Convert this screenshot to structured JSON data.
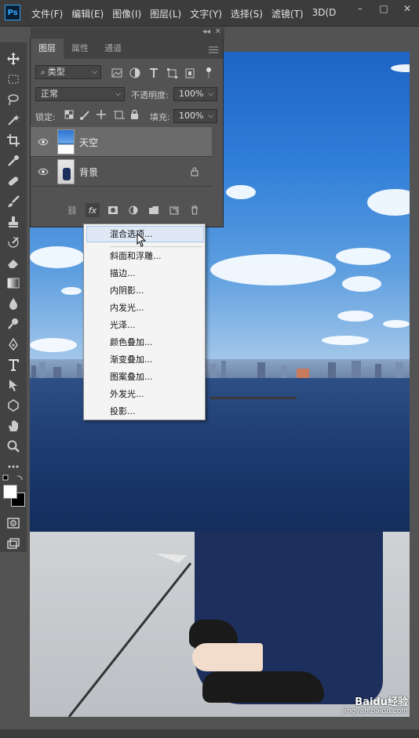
{
  "app": {
    "logo": "Ps"
  },
  "menubar": {
    "items": [
      "文件(F)",
      "编辑(E)",
      "图像(I)",
      "图层(L)",
      "文字(Y)",
      "选择(S)",
      "滤镜(T)",
      "3D(D"
    ]
  },
  "window_controls": [
    "–",
    "□",
    "✕"
  ],
  "panel": {
    "collapse_glyph": "◂◂",
    "close_glyph": "✕",
    "tabs": [
      "图层",
      "属性",
      "通道"
    ],
    "filter_kind": "类型",
    "blend_mode": "正常",
    "opacity_label": "不透明度:",
    "opacity_value": "100%",
    "lock_label": "锁定:",
    "fill_label": "填充:",
    "fill_value": "100%",
    "layers": [
      {
        "name": "天空",
        "selected": true
      },
      {
        "name": "背景",
        "selected": false,
        "locked": true
      }
    ],
    "fx_label": "fx"
  },
  "context_menu": {
    "items": [
      "混合选项...",
      "斜面和浮雕...",
      "描边...",
      "内阴影...",
      "内发光...",
      "光泽...",
      "颜色叠加...",
      "渐变叠加...",
      "图案叠加...",
      "外发光...",
      "投影..."
    ],
    "highlighted": "混合选项..."
  },
  "watermark": {
    "brand": "Baidu经验",
    "url": "jingyan.baidu.com"
  },
  "colors": {
    "menubar": "#3c3c3c",
    "panel": "#535353",
    "selected_layer": "#6b6b6b",
    "menu_highlight": "#dfe9f6"
  }
}
